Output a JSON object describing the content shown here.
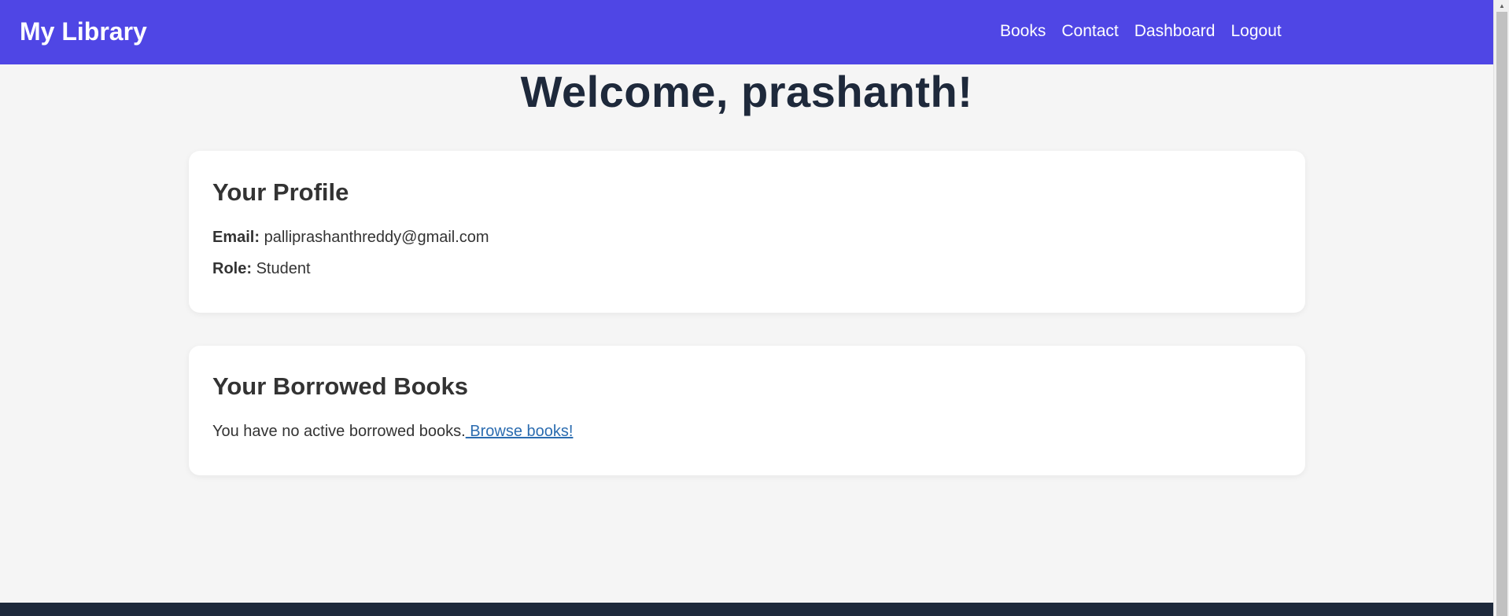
{
  "navbar": {
    "brand": "My Library",
    "links": [
      "Books",
      "Contact",
      "Dashboard",
      "Logout"
    ],
    "background": "#4f46e5"
  },
  "welcome": "Welcome, prashanth!",
  "profile": {
    "title": "Your Profile",
    "email_label": "Email:",
    "email_value": "palliprashanthreddy@gmail.com",
    "role_label": "Role:",
    "role_value": "Student"
  },
  "borrowed": {
    "title": "Your Borrowed Books",
    "message": "You have no active borrowed books.",
    "link": " Browse books!"
  },
  "colors": {
    "page_bg": "#f5f5f5",
    "heading": "#1e293b",
    "link": "#2b6cb0",
    "footer": "#1e293b"
  },
  "scrollbar": {
    "up_icon": "chevron-up-icon"
  }
}
